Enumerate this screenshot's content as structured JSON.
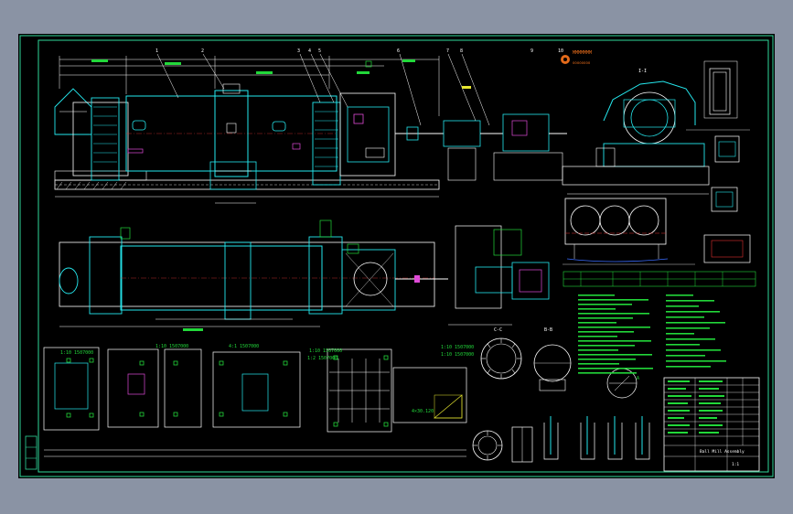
{
  "drawing": {
    "logo_text": "MMMMMMM",
    "logo_subtext": "oooooooo",
    "section_c": "C-C",
    "section_b": "B-B",
    "section_mark_a": "A",
    "note_dims": [
      "1:10  1507000",
      "1:10  1507000",
      "4:1  1507000",
      "1:10  1507000",
      "1:2  1507000",
      "1:10  1507000",
      "1:10  1507000",
      "4×30.120"
    ],
    "view_label": "I-I",
    "part_numbers": [
      "1",
      "2",
      "3",
      "4",
      "5",
      "6",
      "7",
      "8",
      "9",
      "10"
    ],
    "title_block_text": [
      "Ball Mill Assembly",
      "1:1"
    ]
  },
  "colors": {
    "paper": "#000000",
    "frame": "#2fd89a",
    "mill": "#25e8ee",
    "lines": "#ffffff",
    "green": "#22d83a",
    "yellow": "#e6e630",
    "magenta": "#e04bd8",
    "red": "#e03030",
    "blue": "#3a6cff",
    "logo": "#e36a1a"
  }
}
